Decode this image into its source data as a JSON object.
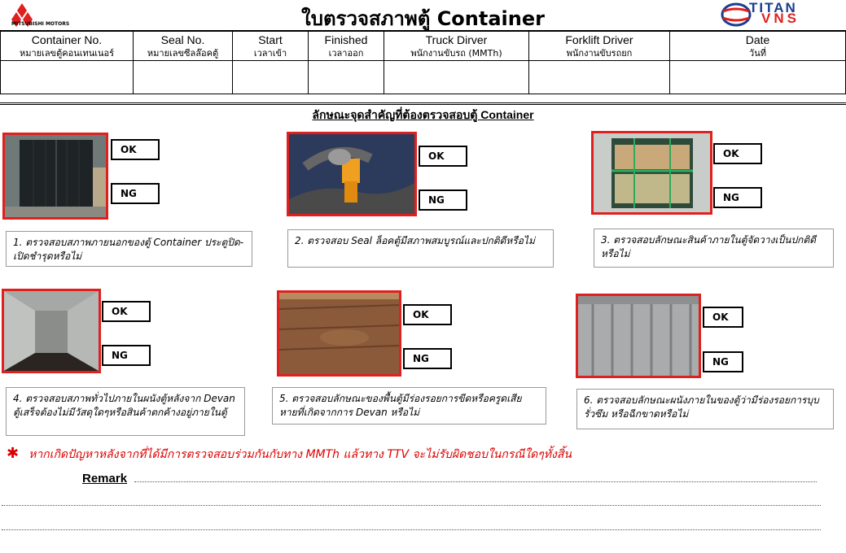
{
  "header": {
    "title": "ใบตรวจสภาพตู้ Container",
    "logo_left_text": "MITSUBISHI MOTORS",
    "logo_right_line1": "TITAN",
    "logo_right_line2": "VNS"
  },
  "info_table": {
    "columns": [
      {
        "en": "Container No.",
        "th": "หมายเลขตู้คอนเทนเนอร์"
      },
      {
        "en": "Seal No.",
        "th": "หมายเลขซีลล๊อคตู้"
      },
      {
        "en": "Start",
        "th": "เวลาเข้า"
      },
      {
        "en": "Finished",
        "th": "เวลาออก"
      },
      {
        "en": "Truck Dirver",
        "th": "พนักงานขับรถ (MMTh)"
      },
      {
        "en": "Forklift Driver",
        "th": "พนักงานขับรถยก"
      },
      {
        "en": "Date",
        "th": "วันที่"
      }
    ]
  },
  "section_title": "ลักษณะจุดสำคัญที่ต้องตรวจสอบตู้ Container",
  "ok_label": "OK",
  "ng_label": "NG",
  "checks": [
    {
      "caption": "1. ตรวจสอบสภาพภายนอกของตู้ Container ประตูปิด-เปิดชำรุดหรือไม่",
      "photo": "container-exterior-photo"
    },
    {
      "caption": "2. ตรวจสอบ Seal ล็อคตู้มีสภาพสมบูรณ์และปกติดีหรือไม่",
      "photo": "seal-lock-photo"
    },
    {
      "caption": "3. ตรวจสอบลักษณะสินค้าภายในตู้จัดวางเป็นปกติดีหรือไม่",
      "photo": "cargo-inside-photo"
    },
    {
      "caption": "4. ตรวจสอบสภาพทั่วไปภายในผนังตู้หลังจาก Devan ตู้เสร็จต้องไม่มีวัสดุใดๆหรือสินค้าตกค้างอยู่ภายในตู้",
      "photo": "empty-interior-photo"
    },
    {
      "caption": "5. ตรวจสอบลักษณะของพื้นตู้มีร่องรอยการขีดหรือครูดเสียหายที่เกิดจากการ Devan หรือไม่",
      "photo": "floor-photo"
    },
    {
      "caption": "6.  ตรวจสอบลักษณะผนังภายในของตู้ว่ามีร่องรอยการบุบ รั่วซึม หรือฉีกขาดหรือไม่",
      "photo": "wall-photo"
    }
  ],
  "warning": {
    "star": "✱",
    "text": "หากเกิดปัญหาหลังจากที่ได้มีการตรวจสอบร่วมกันกับทาง MMTh แล้วทาง TTV จะไม่รับผิดชอบในกรณีใดๆทั้งสิ้น"
  },
  "remark_label": "Remark"
}
